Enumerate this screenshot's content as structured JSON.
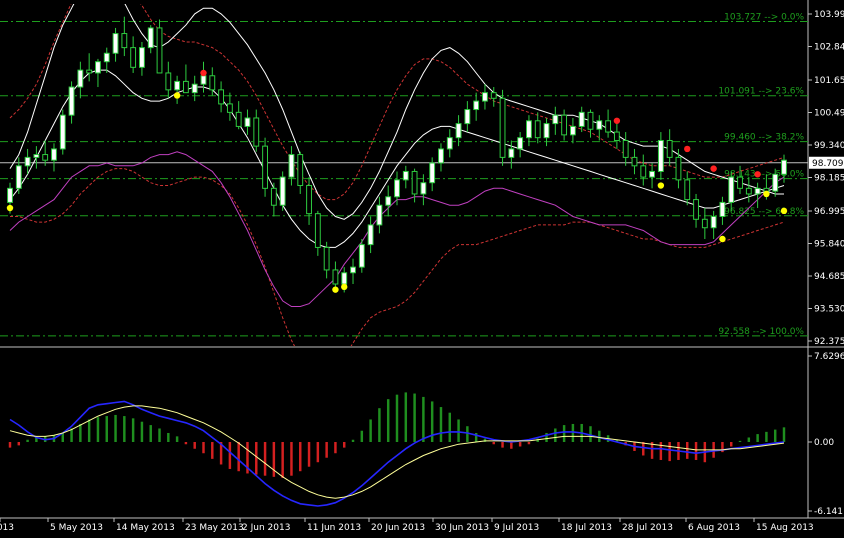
{
  "colors": {
    "background": "#000000",
    "grid": "#1e9e1e",
    "bull_candle_body": "#ffffff",
    "bear_candle_body": "#000000",
    "candle_wick": "#2ecc40",
    "upper_band": "#cc3333",
    "middle_band": "#ffffff",
    "lower_band": "#c040c0",
    "macd_line": "#2626ff",
    "signal_line": "#ffff99",
    "hist_up": "#1f8f1f",
    "hist_down": "#d42020",
    "fractal_up": "#ff2020",
    "fractal_down": "#ffff00",
    "current_price_line": "#c0c0c0",
    "text": "#ffffff"
  },
  "price_axis": {
    "labels": [
      "103.995",
      "102.840",
      "101.650",
      "100.495",
      "99.340",
      "98.185",
      "96.995",
      "95.840",
      "94.685",
      "93.530",
      "92.375"
    ],
    "current_price": "98.709"
  },
  "macd_axis": {
    "labels": [
      "7.6296",
      "0.00",
      "-6.141"
    ]
  },
  "fib_levels": [
    {
      "label": "103.727 --> 0.0%",
      "price": 103.727
    },
    {
      "label": "101.091 --> 23.6%",
      "price": 101.091
    },
    {
      "label": "99.460 --> 38.2%",
      "price": 99.46
    },
    {
      "label": "98.143 --> 50.0%",
      "price": 98.143
    },
    {
      "label": "96.825 --> 61.8%",
      "price": 96.825
    },
    {
      "label": "92.558 --> 100.0%",
      "price": 92.558
    }
  ],
  "time_axis": {
    "labels": [
      "2013",
      "5 May 2013",
      "14 May 2013",
      "23 May 2013",
      "2 Jun 2013",
      "11 Jun 2013",
      "20 Jun 2013",
      "30 Jun 2013",
      "9 Jul 2013",
      "18 Jul 2013",
      "28 Jul 2013",
      "6 Aug 2013",
      "15 Aug 2013"
    ]
  },
  "chart_data": {
    "type": "candlestick",
    "symbol_timeframe": "",
    "price_range": [
      92.375,
      104.2
    ],
    "macd_range": [
      -6.141,
      7.6296
    ],
    "candles": [
      [
        97.3,
        98.0,
        96.9,
        97.8
      ],
      [
        97.8,
        98.9,
        97.6,
        98.6
      ],
      [
        98.6,
        99.2,
        98.3,
        98.9
      ],
      [
        98.9,
        99.3,
        98.5,
        99.0
      ],
      [
        99.0,
        99.5,
        98.6,
        98.8
      ],
      [
        98.8,
        99.4,
        98.4,
        99.2
      ],
      [
        99.2,
        100.6,
        99.0,
        100.4
      ],
      [
        100.4,
        101.6,
        100.1,
        101.4
      ],
      [
        101.4,
        102.3,
        101.0,
        102.0
      ],
      [
        102.0,
        102.6,
        101.6,
        101.9
      ],
      [
        101.9,
        102.4,
        101.4,
        102.3
      ],
      [
        102.3,
        102.8,
        101.9,
        102.6
      ],
      [
        102.6,
        103.5,
        102.3,
        103.3
      ],
      [
        103.3,
        103.9,
        102.5,
        102.8
      ],
      [
        102.8,
        103.2,
        101.9,
        102.1
      ],
      [
        102.1,
        103.0,
        101.8,
        102.8
      ],
      [
        102.8,
        103.6,
        102.6,
        103.5
      ],
      [
        103.5,
        103.8,
        101.9,
        101.9
      ],
      [
        101.9,
        102.3,
        101.0,
        101.3
      ],
      [
        101.3,
        101.8,
        100.8,
        101.6
      ],
      [
        101.6,
        102.2,
        101.2,
        101.2
      ],
      [
        101.2,
        101.8,
        100.9,
        101.5
      ],
      [
        101.5,
        102.3,
        101.2,
        101.8
      ],
      [
        101.8,
        102.1,
        101.1,
        101.3
      ],
      [
        101.3,
        101.6,
        100.5,
        100.8
      ],
      [
        100.8,
        101.2,
        100.2,
        100.5
      ],
      [
        100.5,
        100.9,
        99.9,
        100.0
      ],
      [
        100.0,
        100.6,
        99.7,
        100.3
      ],
      [
        100.3,
        100.6,
        99.1,
        99.3
      ],
      [
        99.3,
        99.6,
        97.5,
        97.8
      ],
      [
        97.8,
        98.0,
        96.8,
        97.2
      ],
      [
        97.2,
        98.4,
        97.0,
        98.2
      ],
      [
        98.2,
        99.3,
        97.9,
        99.0
      ],
      [
        99.0,
        99.1,
        97.6,
        97.9
      ],
      [
        97.9,
        98.2,
        96.5,
        96.9
      ],
      [
        96.9,
        97.0,
        95.4,
        95.7
      ],
      [
        95.7,
        95.9,
        94.6,
        94.9
      ],
      [
        94.9,
        95.2,
        94.2,
        94.4
      ],
      [
        94.4,
        95.0,
        94.1,
        94.8
      ],
      [
        94.8,
        95.3,
        94.4,
        95.0
      ],
      [
        95.0,
        96.0,
        94.8,
        95.8
      ],
      [
        95.8,
        96.8,
        95.5,
        96.5
      ],
      [
        96.5,
        97.5,
        96.2,
        97.2
      ],
      [
        97.2,
        97.9,
        96.8,
        97.5
      ],
      [
        97.5,
        98.4,
        97.2,
        98.1
      ],
      [
        98.1,
        98.6,
        97.8,
        98.4
      ],
      [
        98.4,
        98.5,
        97.3,
        97.6
      ],
      [
        97.6,
        98.3,
        97.2,
        98.0
      ],
      [
        98.0,
        98.9,
        97.7,
        98.7
      ],
      [
        98.7,
        99.4,
        98.4,
        99.2
      ],
      [
        99.2,
        99.9,
        98.9,
        99.6
      ],
      [
        99.6,
        100.4,
        99.3,
        100.1
      ],
      [
        100.1,
        100.9,
        99.8,
        100.6
      ],
      [
        100.6,
        101.2,
        100.2,
        100.9
      ],
      [
        100.9,
        101.5,
        100.6,
        101.2
      ],
      [
        101.2,
        101.4,
        100.7,
        101.0
      ],
      [
        101.0,
        101.3,
        98.6,
        98.9
      ],
      [
        98.9,
        99.5,
        98.5,
        99.2
      ],
      [
        99.2,
        99.8,
        98.9,
        99.6
      ],
      [
        99.6,
        100.4,
        99.3,
        100.2
      ],
      [
        100.2,
        100.5,
        99.4,
        99.6
      ],
      [
        99.6,
        100.3,
        99.3,
        100.1
      ],
      [
        100.1,
        100.7,
        99.7,
        100.4
      ],
      [
        100.4,
        100.6,
        99.5,
        99.7
      ],
      [
        99.7,
        100.3,
        99.4,
        100.0
      ],
      [
        100.0,
        100.7,
        99.8,
        100.5
      ],
      [
        100.5,
        100.6,
        99.6,
        99.9
      ],
      [
        99.9,
        100.4,
        99.5,
        100.2
      ],
      [
        100.2,
        100.6,
        99.6,
        99.8
      ],
      [
        99.8,
        100.2,
        99.2,
        99.5
      ],
      [
        99.5,
        99.8,
        98.6,
        98.9
      ],
      [
        98.9,
        99.2,
        98.3,
        98.6
      ],
      [
        98.6,
        99.0,
        97.9,
        98.2
      ],
      [
        98.2,
        98.7,
        97.8,
        98.4
      ],
      [
        98.4,
        99.8,
        98.1,
        99.5
      ],
      [
        99.5,
        99.9,
        98.6,
        98.9
      ],
      [
        98.9,
        99.2,
        97.8,
        98.1
      ],
      [
        98.1,
        98.4,
        97.2,
        97.4
      ],
      [
        97.4,
        97.6,
        96.4,
        96.7
      ],
      [
        96.7,
        97.1,
        96.0,
        96.4
      ],
      [
        96.4,
        97.0,
        96.0,
        96.8
      ],
      [
        96.8,
        97.5,
        96.5,
        97.3
      ],
      [
        97.3,
        98.4,
        97.0,
        98.2
      ],
      [
        98.2,
        98.6,
        97.6,
        97.8
      ],
      [
        97.8,
        98.2,
        97.3,
        97.6
      ],
      [
        97.6,
        98.0,
        97.1,
        97.8
      ],
      [
        97.8,
        98.3,
        97.4,
        97.7
      ],
      [
        97.7,
        98.5,
        97.5,
        98.3
      ],
      [
        98.3,
        99.0,
        98.0,
        98.8
      ]
    ],
    "upper_band": [
      98.5,
      99.0,
      99.8,
      100.8,
      101.8,
      102.8,
      103.6,
      104.2,
      104.8,
      105.2,
      105.4,
      105.3,
      105.0,
      104.4,
      103.8,
      103.3,
      102.9,
      102.8,
      103.0,
      103.3,
      103.6,
      104.0,
      104.2,
      104.2,
      104.0,
      103.7,
      103.3,
      102.9,
      102.4,
      101.9,
      101.3,
      100.6,
      99.8,
      99.0,
      98.3,
      97.6,
      97.1,
      96.8,
      96.7,
      96.9,
      97.3,
      97.8,
      98.4,
      99.1,
      99.8,
      100.6,
      101.3,
      101.9,
      102.4,
      102.7,
      102.8,
      102.6,
      102.3,
      101.9,
      101.5,
      101.2,
      101.0,
      100.9,
      100.8,
      100.7,
      100.6,
      100.5,
      100.4,
      100.4,
      100.4,
      100.3,
      100.2,
      100.1,
      99.9,
      99.7,
      99.5,
      99.4,
      99.3,
      99.3,
      99.3,
      99.2,
      99.0,
      98.8,
      98.6,
      98.4,
      98.3,
      98.2,
      98.1,
      98.0,
      97.9,
      97.8,
      97.7,
      97.6,
      97.6
    ],
    "middle_band": [
      97.4,
      97.8,
      98.3,
      98.9,
      99.5,
      100.1,
      100.7,
      101.2,
      101.6,
      101.9,
      102.0,
      102.0,
      101.8,
      101.5,
      101.2,
      101.0,
      100.9,
      100.9,
      101.0,
      101.2,
      101.3,
      101.4,
      101.4,
      101.3,
      101.0,
      100.6,
      100.1,
      99.6,
      99.0,
      98.4,
      97.8,
      97.2,
      96.7,
      96.3,
      96.0,
      95.8,
      95.7,
      95.7,
      95.9,
      96.2,
      96.6,
      97.1,
      97.6,
      98.1,
      98.6,
      99.0,
      99.4,
      99.7,
      99.9,
      100.0,
      100.0,
      99.9,
      99.8,
      99.7,
      99.6,
      99.5,
      99.4,
      99.3,
      99.2,
      99.1,
      99.0,
      98.9,
      98.8,
      98.7,
      98.6,
      98.5,
      98.4,
      98.3,
      98.2,
      98.1,
      98.0,
      97.9,
      97.8,
      97.7,
      97.6,
      97.5,
      97.4,
      97.3,
      97.2,
      97.1,
      97.1,
      97.2,
      97.3,
      97.4,
      97.5,
      97.6,
      97.7,
      97.8,
      97.9
    ],
    "lower_band": [
      96.3,
      96.6,
      96.8,
      97.0,
      97.2,
      97.4,
      97.8,
      98.2,
      98.4,
      98.6,
      98.6,
      98.7,
      98.6,
      98.6,
      98.6,
      98.7,
      98.9,
      99.0,
      99.0,
      99.1,
      99.0,
      98.8,
      98.6,
      98.4,
      98.0,
      97.5,
      96.9,
      96.3,
      95.6,
      94.9,
      94.3,
      93.8,
      93.6,
      93.6,
      93.7,
      94.0,
      94.3,
      94.6,
      95.1,
      95.5,
      95.9,
      96.4,
      96.8,
      97.1,
      97.4,
      97.4,
      97.5,
      97.5,
      97.4,
      97.3,
      97.2,
      97.2,
      97.3,
      97.5,
      97.7,
      97.8,
      97.8,
      97.7,
      97.6,
      97.5,
      97.4,
      97.3,
      97.2,
      97.0,
      96.8,
      96.7,
      96.6,
      96.5,
      96.5,
      96.5,
      96.5,
      96.4,
      96.3,
      96.1,
      95.9,
      95.8,
      95.8,
      95.8,
      95.8,
      95.8,
      95.9,
      96.2,
      96.5,
      96.8,
      97.1,
      97.4,
      97.7,
      98.0,
      98.2
    ],
    "env_upper": [
      100.3,
      100.6,
      101.0,
      101.5,
      102.2,
      103.0,
      103.7,
      104.4,
      105.0,
      105.3,
      105.4,
      105.4,
      105.3,
      105.1,
      104.7,
      104.3,
      103.8,
      103.4,
      103.2,
      103.1,
      103.0,
      103.0,
      102.9,
      102.8,
      102.6,
      102.3,
      102.0,
      101.6,
      101.1,
      100.5,
      99.9,
      99.3,
      98.8,
      98.3,
      97.9,
      97.6,
      97.4,
      97.4,
      97.6,
      98.0,
      98.6,
      99.3,
      100.0,
      100.7,
      101.3,
      101.8,
      102.2,
      102.4,
      102.4,
      102.3,
      102.1,
      101.8,
      101.5,
      101.3,
      101.1,
      100.9,
      100.8,
      100.7,
      100.6,
      100.5,
      100.4,
      100.3,
      100.2,
      100.1,
      100.0,
      99.9,
      99.8,
      99.6,
      99.4,
      99.2,
      99.0,
      98.8,
      98.7,
      98.6,
      98.6,
      98.6,
      98.5,
      98.4,
      98.3,
      98.2,
      98.2,
      98.2,
      98.3,
      98.4,
      98.5,
      98.6,
      98.7,
      98.8,
      98.9
    ],
    "env_lower": [
      96.8,
      96.8,
      96.7,
      96.6,
      96.6,
      96.7,
      96.9,
      97.2,
      97.6,
      97.9,
      98.2,
      98.4,
      98.5,
      98.5,
      98.4,
      98.2,
      98.0,
      97.9,
      97.9,
      98.0,
      98.1,
      98.2,
      98.2,
      98.1,
      97.9,
      97.6,
      97.1,
      96.5,
      95.8,
      95.0,
      94.1,
      93.2,
      92.4,
      91.8,
      91.4,
      91.2,
      91.2,
      91.4,
      91.8,
      92.3,
      92.8,
      93.2,
      93.4,
      93.5,
      93.6,
      93.8,
      94.1,
      94.5,
      94.9,
      95.3,
      95.6,
      95.8,
      95.8,
      95.8,
      95.9,
      96.0,
      96.1,
      96.2,
      96.3,
      96.4,
      96.5,
      96.5,
      96.5,
      96.5,
      96.6,
      96.6,
      96.6,
      96.5,
      96.4,
      96.3,
      96.2,
      96.1,
      96.0,
      96.0,
      95.9,
      95.8,
      95.7,
      95.7,
      95.7,
      95.7,
      95.8,
      95.9,
      96.0,
      96.1,
      96.2,
      96.3,
      96.4,
      96.5,
      96.6
    ],
    "fractals_up": [
      [
        19,
        101.1
      ],
      [
        22,
        101.9
      ],
      [
        69,
        100.2
      ],
      [
        77,
        99.2
      ],
      [
        80,
        98.5
      ],
      [
        85,
        98.3
      ]
    ],
    "fractals_down": [
      [
        0,
        97.1
      ],
      [
        19,
        101.1
      ],
      [
        37,
        94.2
      ],
      [
        38,
        94.3
      ],
      [
        74,
        97.9
      ],
      [
        81,
        96.0
      ],
      [
        86,
        97.6
      ],
      [
        88,
        97.0
      ]
    ],
    "macd_hist": [
      -0.5,
      -0.3,
      0.2,
      0.4,
      0.5,
      0.6,
      0.8,
      1.2,
      1.6,
      2.0,
      2.2,
      2.3,
      2.4,
      2.3,
      2.1,
      1.8,
      1.5,
      1.2,
      0.8,
      0.5,
      -0.2,
      -0.6,
      -1.0,
      -1.5,
      -2.0,
      -2.4,
      -2.6,
      -2.8,
      -2.9,
      -3.0,
      -3.1,
      -3.2,
      -3.0,
      -2.6,
      -2.2,
      -1.8,
      -1.4,
      -1.0,
      -0.5,
      0.2,
      1.0,
      2.0,
      3.0,
      3.8,
      4.2,
      4.4,
      4.3,
      4.0,
      3.6,
      3.1,
      2.6,
      2.0,
      1.4,
      0.8,
      0.3,
      -0.2,
      -0.5,
      -0.6,
      -0.4,
      -0.2,
      0.3,
      0.8,
      1.2,
      1.5,
      1.6,
      1.6,
      1.4,
      1.0,
      0.6,
      0.2,
      -0.3,
      -0.8,
      -1.2,
      -1.5,
      -1.6,
      -1.7,
      -1.6,
      -1.5,
      -1.6,
      -1.8,
      -1.4,
      -0.9,
      -0.4,
      0.1,
      0.4,
      0.7,
      0.9,
      1.1,
      1.3
    ],
    "macd_line": [
      2.0,
      1.5,
      0.9,
      0.4,
      0.2,
      0.3,
      0.8,
      1.4,
      2.2,
      3.0,
      3.3,
      3.4,
      3.5,
      3.6,
      3.3,
      2.9,
      2.6,
      2.3,
      2.1,
      1.9,
      1.7,
      1.4,
      1.0,
      0.4,
      -0.2,
      -0.9,
      -1.6,
      -2.3,
      -3.0,
      -3.7,
      -4.3,
      -4.8,
      -5.2,
      -5.5,
      -5.6,
      -5.7,
      -5.6,
      -5.4,
      -5.0,
      -4.5,
      -3.9,
      -3.2,
      -2.5,
      -1.8,
      -1.2,
      -0.6,
      -0.1,
      0.3,
      0.6,
      0.8,
      0.9,
      0.9,
      0.8,
      0.6,
      0.4,
      0.2,
      0.1,
      0.0,
      0.1,
      0.2,
      0.4,
      0.6,
      0.8,
      0.9,
      0.9,
      0.8,
      0.6,
      0.4,
      0.2,
      0.0,
      -0.2,
      -0.4,
      -0.5,
      -0.6,
      -0.6,
      -0.7,
      -0.8,
      -0.9,
      -1.0,
      -0.9,
      -0.8,
      -0.7,
      -0.6,
      -0.5,
      -0.4,
      -0.3,
      -0.2,
      -0.1,
      0.0
    ],
    "signal_line": [
      1.0,
      0.8,
      0.6,
      0.5,
      0.5,
      0.6,
      0.8,
      1.1,
      1.5,
      1.9,
      2.3,
      2.6,
      2.9,
      3.1,
      3.2,
      3.2,
      3.1,
      3.0,
      2.8,
      2.6,
      2.3,
      2.0,
      1.7,
      1.3,
      0.9,
      0.4,
      -0.1,
      -0.7,
      -1.3,
      -1.9,
      -2.5,
      -3.1,
      -3.6,
      -4.0,
      -4.4,
      -4.7,
      -4.9,
      -5.0,
      -4.9,
      -4.7,
      -4.4,
      -4.0,
      -3.5,
      -3.0,
      -2.5,
      -2.0,
      -1.6,
      -1.2,
      -0.9,
      -0.6,
      -0.4,
      -0.2,
      -0.1,
      0.0,
      0.1,
      0.1,
      0.1,
      0.1,
      0.1,
      0.1,
      0.2,
      0.3,
      0.4,
      0.5,
      0.5,
      0.5,
      0.5,
      0.4,
      0.3,
      0.2,
      0.1,
      0.0,
      -0.1,
      -0.2,
      -0.3,
      -0.4,
      -0.5,
      -0.6,
      -0.7,
      -0.7,
      -0.7,
      -0.7,
      -0.6,
      -0.6,
      -0.5,
      -0.4,
      -0.3,
      -0.2,
      -0.1
    ]
  }
}
